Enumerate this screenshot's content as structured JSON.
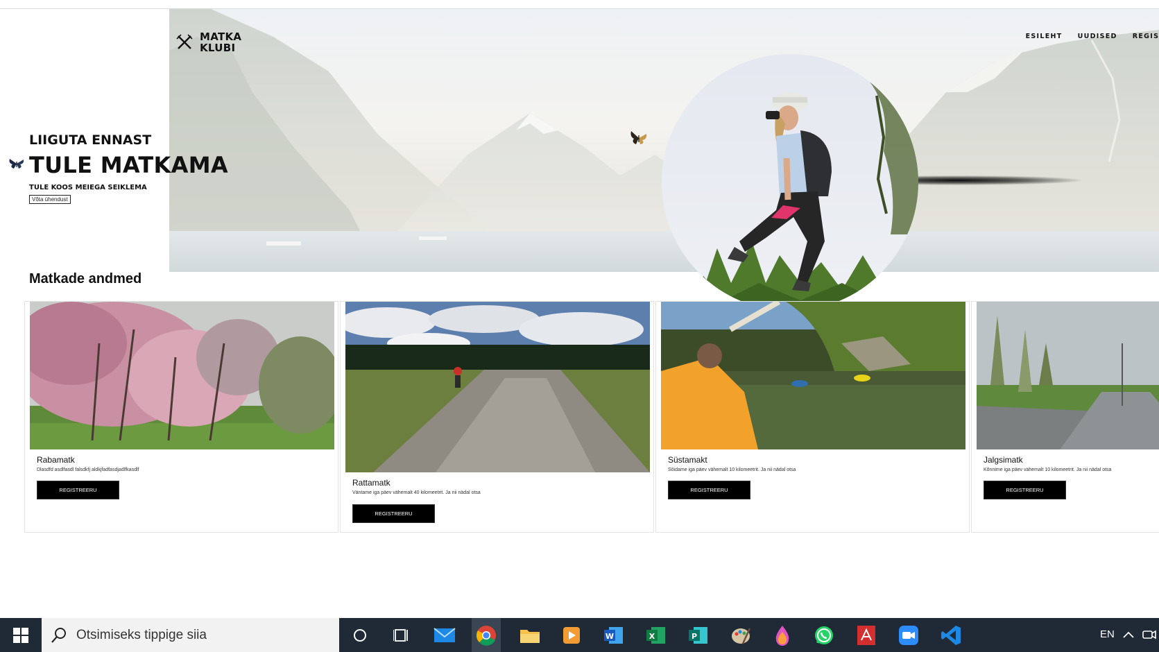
{
  "site": {
    "logo_line1": "MATKA",
    "logo_line2": "KLUBI"
  },
  "nav": {
    "items": [
      "ESILEHT",
      "UUDISED",
      "REGIST"
    ]
  },
  "hero": {
    "eyebrow": "LIIGUTA ENNAST",
    "headline": "TULE MATKAMA",
    "tagline": "TULE KOOS MEIEGA SEIKLEMA",
    "contact_button": "Võta ühendust"
  },
  "section": {
    "title": "Matkade andmed"
  },
  "cards": [
    {
      "title": "Rabamatk",
      "description": "Dlasdfd asdlfasdl falsdkfj aldkjfadfasdjadlfkasdlf",
      "button": "REGISTREERU"
    },
    {
      "title": "Rattamatk",
      "description": "Väntame iga päev vähemalt 40 kilomeetrit. Ja nii nädal otsa",
      "button": "REGISTREERU"
    },
    {
      "title": "Süstamakt",
      "description": "Sõidame iga päev vähemalt 10 kilomeetrit. Ja nii nädal otsa",
      "button": "REGISTREERU"
    },
    {
      "title": "Jalgsimatk",
      "description": "Kõnnime iga päev vähemalt 10 kilomeetrit. Ja nii nädal otsa",
      "button": "REGISTREERU"
    }
  ],
  "taskbar": {
    "search_placeholder": "Otsimiseks tippige siia",
    "language": "EN",
    "apps": [
      "cortana-icon",
      "task-view-icon",
      "mail-icon",
      "chrome-icon",
      "file-explorer-icon",
      "media-player-icon",
      "word-icon",
      "excel-icon",
      "publisher-icon",
      "paint-icon",
      "paint3d-icon",
      "whatsapp-icon",
      "acrobat-icon",
      "zoom-icon",
      "vscode-icon"
    ]
  },
  "colors": {
    "taskbar": "#1f2a36",
    "button": "#000000"
  }
}
